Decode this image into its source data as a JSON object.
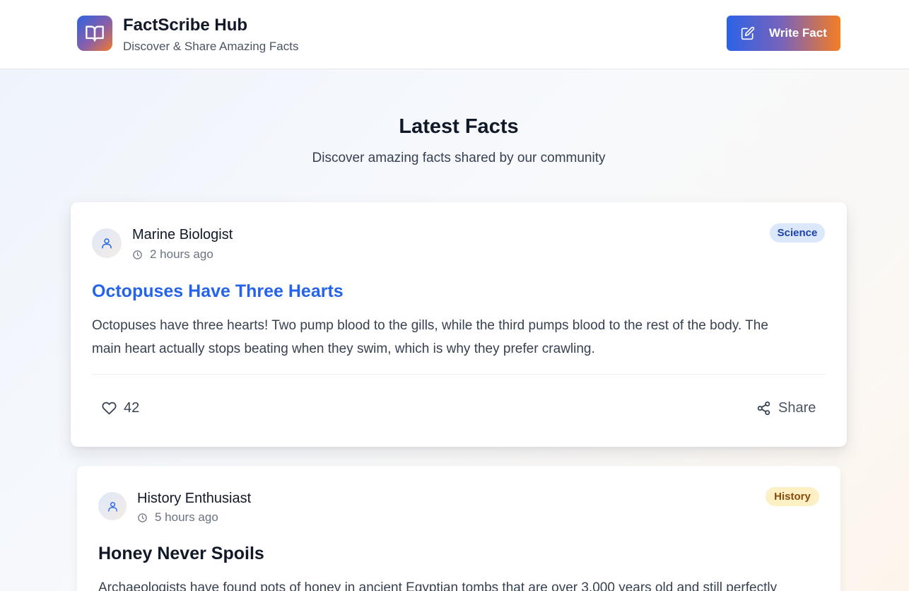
{
  "header": {
    "brand_title": "FactScribe Hub",
    "brand_subtitle": "Discover & Share Amazing Facts",
    "write_button_label": "Write Fact"
  },
  "section": {
    "title": "Latest Facts",
    "subtitle": "Discover amazing facts shared by our community"
  },
  "facts": [
    {
      "author": "Marine Biologist",
      "time": "2 hours ago",
      "category": "Science",
      "title": "Octopuses Have Three Hearts",
      "body_line1": "Octopuses have three hearts! Two pump blood to the gills, while the third pumps blood to the rest of the body. The",
      "body_line2": "main heart actually stops beating when they swim, which is why they prefer crawling.",
      "likes": "42",
      "share_label": "Share"
    },
    {
      "author": "History Enthusiast",
      "time": "5 hours ago",
      "category": "History",
      "title": "Honey Never Spoils",
      "body_line1": "Archaeologists have found pots of honey in ancient Egyptian tombs that are over 3,000 years old and still perfectly"
    }
  ],
  "colors": {
    "accent_blue": "#2563eb",
    "accent_orange": "#f57d22",
    "science_badge_bg": "#dbe7fb",
    "history_badge_bg": "#fdf0c4"
  },
  "icons": {
    "logo": "open-book-icon",
    "write": "edit-icon",
    "avatar": "user-icon",
    "time": "clock-icon",
    "like": "heart-icon",
    "share": "share-icon"
  }
}
